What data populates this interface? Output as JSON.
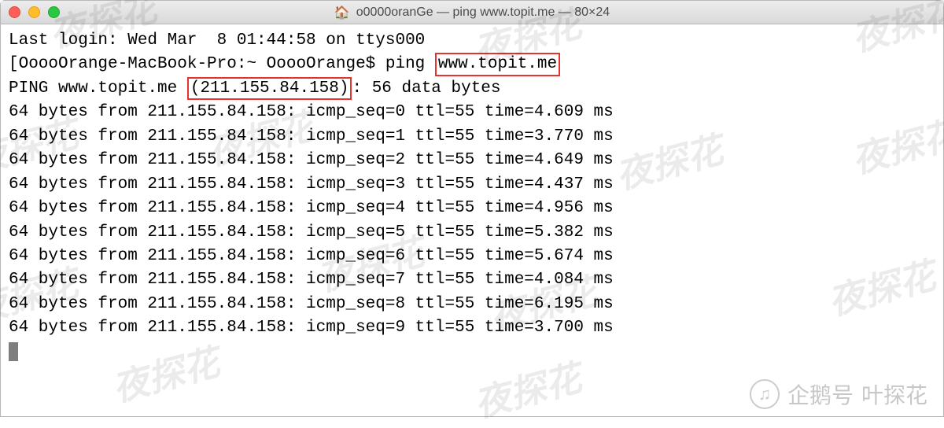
{
  "window": {
    "title": "o0000oranGe — ping www.topit.me — 80×24"
  },
  "terminal": {
    "last_login": "Last login: Wed Mar  8 01:44:58 on ttys000",
    "prompt_prefix": "[OoooOrange-MacBook-Pro:~ OoooOrange$ ping ",
    "ping_target": "www.topit.me",
    "ping_header_prefix": "PING www.topit.me ",
    "ping_ip": "(211.155.84.158)",
    "ping_header_suffix": ": 56 data bytes",
    "source_ip": "211.155.84.158",
    "ttl": 55,
    "bytes": 64,
    "replies": [
      {
        "seq": 0,
        "time": "4.609"
      },
      {
        "seq": 1,
        "time": "3.770"
      },
      {
        "seq": 2,
        "time": "4.649"
      },
      {
        "seq": 3,
        "time": "4.437"
      },
      {
        "seq": 4,
        "time": "4.956"
      },
      {
        "seq": 5,
        "time": "5.382"
      },
      {
        "seq": 6,
        "time": "5.674"
      },
      {
        "seq": 7,
        "time": "4.084"
      },
      {
        "seq": 8,
        "time": "6.195"
      },
      {
        "seq": 9,
        "time": "3.700"
      }
    ]
  },
  "watermark_text": "夜探花",
  "attribution": {
    "prefix": "企鹅号",
    "name": "叶探花"
  }
}
